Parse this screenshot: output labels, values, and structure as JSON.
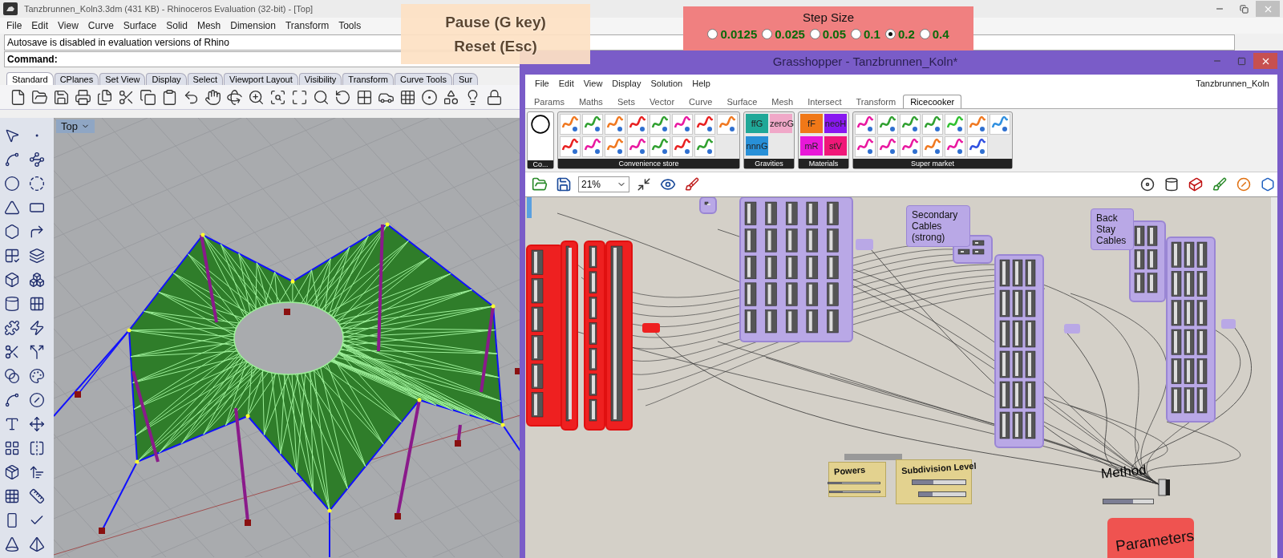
{
  "rhino": {
    "title": "Tanzbrunnen_Koln3.3dm (431 KB) - Rhinoceros Evaluation (32-bit) - [Top]",
    "menu": [
      "File",
      "Edit",
      "View",
      "Curve",
      "Surface",
      "Solid",
      "Mesh",
      "Dimension",
      "Transform",
      "Tools"
    ],
    "autosave_message": "Autosave is disabled in evaluation versions of Rhino",
    "command_label": "Command:",
    "toolbar_tabs": [
      {
        "label": "Standard",
        "selected": true
      },
      {
        "label": "CPlanes",
        "selected": false
      },
      {
        "label": "Set View",
        "selected": false
      },
      {
        "label": "Display",
        "selected": false
      },
      {
        "label": "Select",
        "selected": false
      },
      {
        "label": "Viewport Layout",
        "selected": false
      },
      {
        "label": "Visibility",
        "selected": false
      },
      {
        "label": "Transform",
        "selected": false
      },
      {
        "label": "Curve Tools",
        "selected": false
      },
      {
        "label": "Sur",
        "selected": false
      }
    ],
    "viewport": {
      "label": "Top"
    }
  },
  "overlays": {
    "pause": "Pause (G key)",
    "reset": "Reset (Esc)",
    "step_size": {
      "title": "Step Size",
      "options": [
        {
          "label": "0.0125",
          "selected": false
        },
        {
          "label": "0.025",
          "selected": false
        },
        {
          "label": "0.05",
          "selected": false
        },
        {
          "label": "0.1",
          "selected": false
        },
        {
          "label": "0.2",
          "selected": true
        },
        {
          "label": "0.4",
          "selected": false
        }
      ]
    }
  },
  "grasshopper": {
    "title": "Grasshopper - Tanzbrunnen_Koln*",
    "menu": [
      "File",
      "Edit",
      "View",
      "Display",
      "Solution",
      "Help"
    ],
    "document_name": "Tanzbrunnen_Koln",
    "tabs": [
      {
        "label": "Params",
        "selected": false
      },
      {
        "label": "Maths",
        "selected": false
      },
      {
        "label": "Sets",
        "selected": false
      },
      {
        "label": "Vector",
        "selected": false
      },
      {
        "label": "Curve",
        "selected": false
      },
      {
        "label": "Surface",
        "selected": false
      },
      {
        "label": "Mesh",
        "selected": false
      },
      {
        "label": "Intersect",
        "selected": false
      },
      {
        "label": "Transform",
        "selected": false
      },
      {
        "label": "Ricecooker",
        "selected": true
      }
    ],
    "first_component": "Co...",
    "panels": [
      {
        "label": "Convenience store"
      },
      {
        "label": "Gravities"
      },
      {
        "label": "Materials"
      },
      {
        "label": "Super market"
      }
    ],
    "gravities": [
      {
        "label": "ffG",
        "color": "#20a898"
      },
      {
        "label": "zeroG",
        "color": "#f0a8c8"
      },
      {
        "label": "nnnG",
        "color": "#2890d8"
      }
    ],
    "materials": [
      {
        "label": "fF",
        "color": "#f07818"
      },
      {
        "label": "neoH",
        "color": "#8818f0"
      },
      {
        "label": "mR",
        "color": "#e818d8"
      },
      {
        "label": "stV",
        "color": "#f01878"
      }
    ],
    "zoom": "21%",
    "canvas": {
      "group_labels": [
        {
          "label": "Secondary Cables (strong)"
        },
        {
          "label": "Back Stay Cables"
        }
      ],
      "slider_panels": [
        {
          "label": "Powers",
          "controls": [
            {
              "level": 0.27
            },
            {
              "level": 0.25
            }
          ]
        },
        {
          "label": "Subdivision Level",
          "controls": [
            {
              "level": 0.4
            },
            {
              "level": 0.3
            }
          ]
        }
      ],
      "method": {
        "label": "Method",
        "level": 0.6
      },
      "parameters_label": "Parameters"
    }
  }
}
